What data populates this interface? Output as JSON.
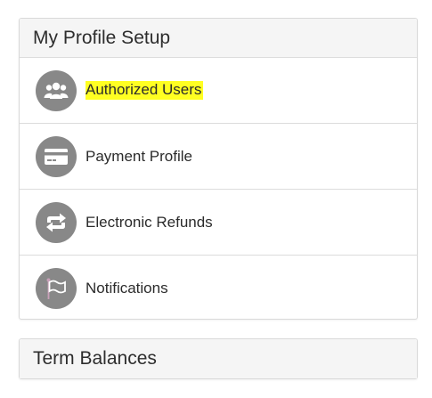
{
  "profile_panel": {
    "title": "My Profile Setup",
    "items": [
      {
        "label": "Authorized Users",
        "icon": "users-icon",
        "highlighted": true
      },
      {
        "label": "Payment Profile",
        "icon": "credit-card-icon",
        "highlighted": false
      },
      {
        "label": "Electronic Refunds",
        "icon": "refresh-arrows-icon",
        "highlighted": false
      },
      {
        "label": "Notifications",
        "icon": "flag-icon",
        "highlighted": false
      }
    ]
  },
  "balances_panel": {
    "title": "Term Balances"
  },
  "colors": {
    "icon_circle": "#888888",
    "highlight": "#ffff22",
    "header_bg": "#f5f5f5"
  }
}
